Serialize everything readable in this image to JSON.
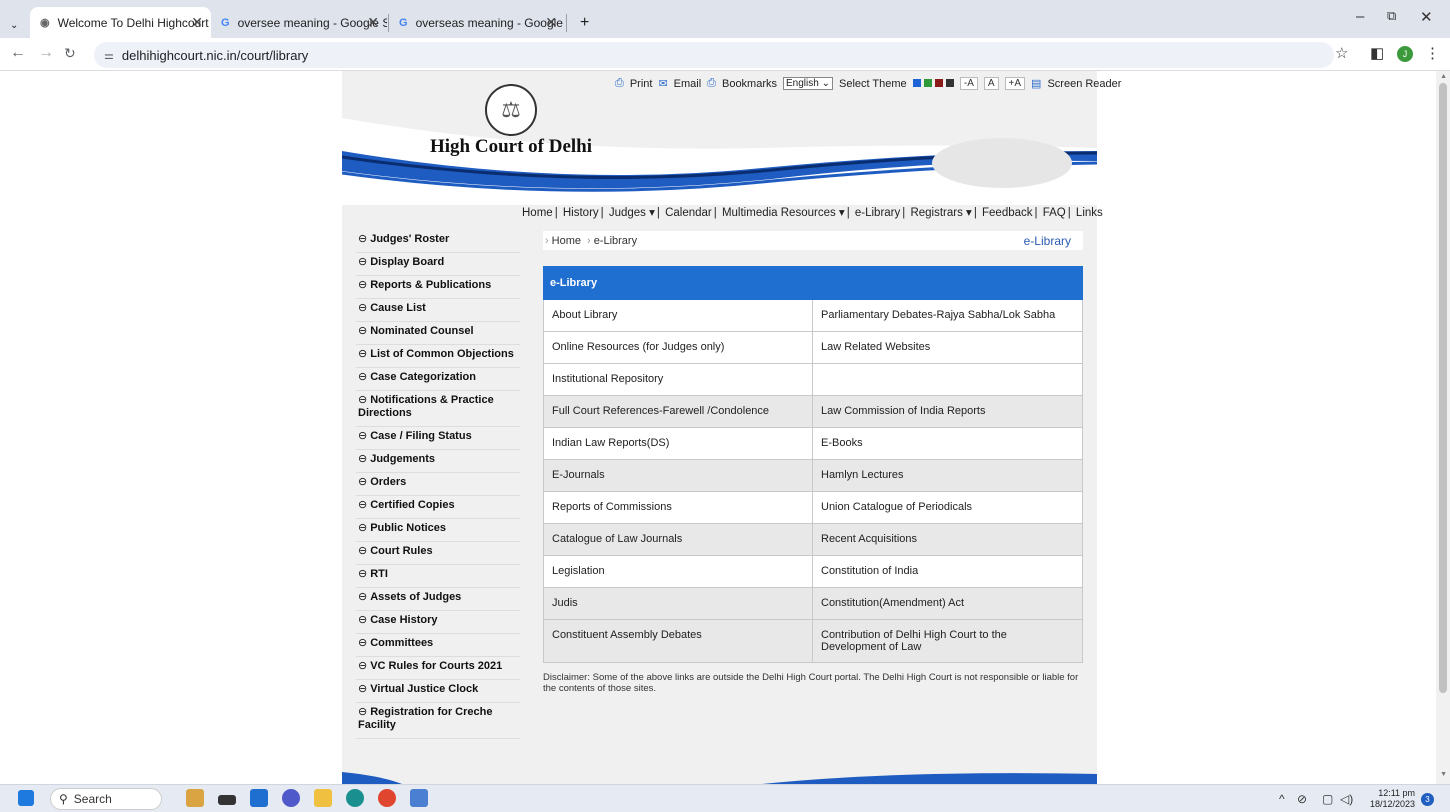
{
  "browser": {
    "tabs": [
      {
        "title": "Welcome To Delhi Highcourt",
        "active": true
      },
      {
        "title": "oversee meaning - Google Sea",
        "active": false
      },
      {
        "title": "overseas meaning - Google Sea",
        "active": false
      }
    ],
    "url": "delhihighcourt.nic.in/court/library",
    "avatar_letter": "J"
  },
  "utility": {
    "print": "Print",
    "email": "Email",
    "bookmarks": "Bookmarks",
    "language": "English",
    "select_theme": "Select Theme",
    "theme_colors": [
      "#1e63d6",
      "#2e9a3a",
      "#8b1a1a",
      "#333333"
    ],
    "font_smaller": "-A",
    "font_normal": "A",
    "font_larger": "+A",
    "screen_reader": "Screen Reader"
  },
  "site": {
    "title": "High Court of Delhi"
  },
  "nav": [
    "Home",
    "History",
    "Judges ▾",
    "Calendar",
    "Multimedia Resources ▾",
    "e-Library",
    "Registrars ▾",
    "Feedback",
    "FAQ",
    "Links"
  ],
  "sidebar": [
    "Judges' Roster",
    "Display Board",
    "Reports & Publications",
    "Cause List",
    "Nominated Counsel",
    "List of Common Objections",
    "Case Categorization",
    "Notifications & Practice Directions",
    "Case / Filing Status",
    "Judgements",
    "Orders",
    "Certified Copies",
    "Public Notices",
    "Court Rules",
    "RTI",
    "Assets of Judges",
    "Case History",
    "Committees",
    "VC Rules for Courts 2021",
    "Virtual Justice Clock",
    "Registration for Creche Facility"
  ],
  "breadcrumb": {
    "home": "Home",
    "current": "e-Library",
    "page_label": "e-Library"
  },
  "library": {
    "heading": "e-Library",
    "rows": [
      [
        "About Library",
        "Parliamentary Debates-Rajya Sabha/Lok Sabha"
      ],
      [
        "Online Resources (for Judges only)",
        "Law Related Websites"
      ],
      [
        "Institutional Repository",
        ""
      ],
      [
        "Full Court References-Farewell /Condolence",
        "Law Commission of India Reports"
      ],
      [
        "Indian Law Reports(DS)",
        "E-Books"
      ],
      [
        "E-Journals",
        "Hamlyn Lectures"
      ],
      [
        "Reports of Commissions",
        "Union Catalogue of Periodicals"
      ],
      [
        "Catalogue of Law Journals",
        "Recent Acquisitions"
      ],
      [
        "Legislation",
        "Constitution of India"
      ],
      [
        "Judis",
        "Constitution(Amendment) Act"
      ],
      [
        "Constituent Assembly Debates",
        "Contribution of Delhi High Court to the Development of Law"
      ]
    ],
    "disclaimer": "Disclaimer: Some of the above links are outside the Delhi High Court portal. The Delhi High Court is not responsible or liable for the contents of those sites."
  },
  "taskbar": {
    "search": "Search",
    "time": "12:11 pm",
    "date": "18/12/2023",
    "notifications": "3"
  }
}
